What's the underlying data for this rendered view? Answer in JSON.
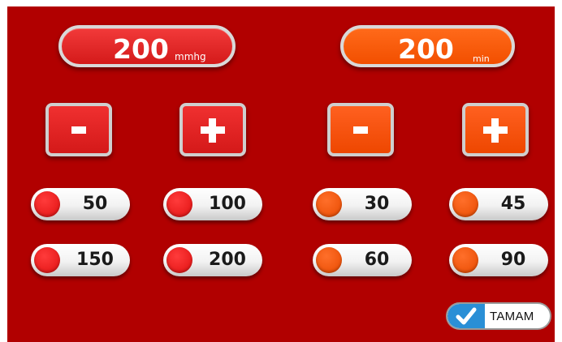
{
  "pressure": {
    "value": "200",
    "unit": "mmhg"
  },
  "time": {
    "value": "200",
    "unit": "min"
  },
  "buttons": {
    "minus": "-",
    "plus": "+"
  },
  "pressure_presets": [
    "50",
    "100",
    "150",
    "200"
  ],
  "time_presets": [
    "30",
    "45",
    "60",
    "90"
  ],
  "confirm": {
    "label": "TAMAM"
  },
  "colors": {
    "background": "#b10000",
    "pressure_accent": "#e52222",
    "time_accent": "#f25000",
    "confirm_check": "#2a8fd6"
  },
  "icons": {
    "confirm": "checkmark-icon"
  }
}
